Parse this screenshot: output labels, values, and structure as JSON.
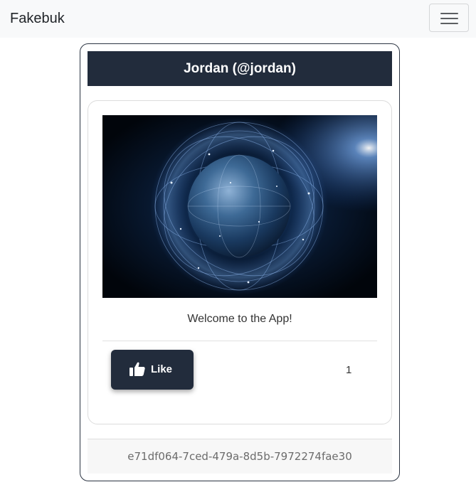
{
  "navbar": {
    "brand": "Fakebuk",
    "menu_icon": "hamburger-menu-icon"
  },
  "profile": {
    "header_title": "Jordan (@jordan)"
  },
  "post": {
    "image_icon": "globe-network-image",
    "caption": "Welcome to the App!",
    "like_label": "Like",
    "like_icon": "thumbs-up-icon",
    "like_count": "1"
  },
  "footer": {
    "id_text": "e71df064-7ced-479a-8d5b-7972274fae30"
  },
  "colors": {
    "navbar_bg": "#f8f9fa",
    "header_bg": "#222c3c",
    "button_bg": "#222c3c",
    "footer_bg": "#f7f7f7"
  }
}
